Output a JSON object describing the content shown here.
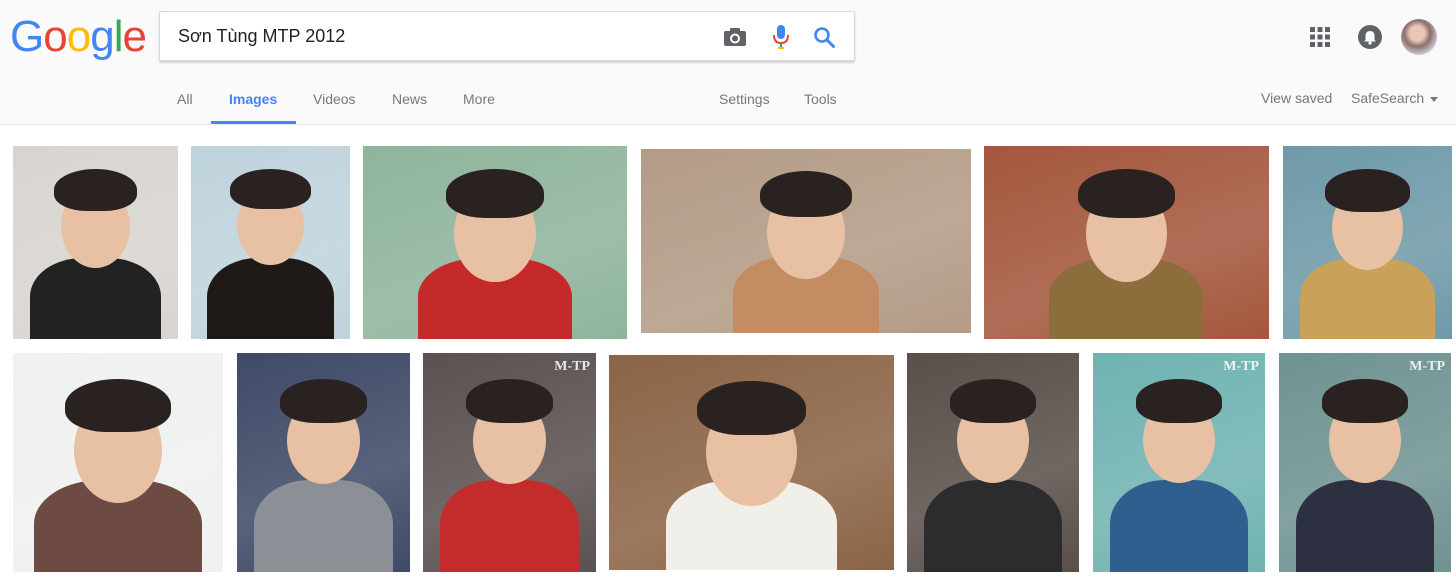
{
  "logo": {
    "text": [
      "G",
      "o",
      "o",
      "g",
      "l",
      "e"
    ],
    "colors": [
      "#4285f4",
      "#ea4335",
      "#fbbc05",
      "#4285f4",
      "#34a853",
      "#ea4335"
    ]
  },
  "search": {
    "query": "Sơn Tùng MTP 2012"
  },
  "icons": {
    "camera": "camera-icon",
    "mic": "microphone-icon",
    "search": "search-icon",
    "apps": "apps-grid-icon",
    "notifications": "notifications-bell-icon",
    "avatar": "account-avatar"
  },
  "tabs": [
    {
      "label": "All"
    },
    {
      "label": "Images",
      "active": true
    },
    {
      "label": "Videos"
    },
    {
      "label": "News"
    },
    {
      "label": "More"
    },
    {
      "label": "Settings"
    },
    {
      "label": "Tools"
    }
  ],
  "right_links": {
    "view_saved": "View saved",
    "safesearch": "SafeSearch"
  },
  "colors": {
    "accent": "#4285f4",
    "text_muted": "#777777",
    "header_bg": "#fafafa"
  },
  "images": [
    {
      "row": 1,
      "bg": "#d8d4cf",
      "accent": "#222222",
      "watermark": ""
    },
    {
      "row": 1,
      "bg": "#bfd3dc",
      "accent": "#1f1a18",
      "watermark": ""
    },
    {
      "row": 1,
      "bg": "#8fb49c",
      "accent": "#c42a2a",
      "watermark": ""
    },
    {
      "row": 1,
      "bg": "#b39b86",
      "accent": "#c48c62",
      "watermark": ""
    },
    {
      "row": 1,
      "bg": "#a4573d",
      "accent": "#8c6d3b",
      "watermark": ""
    },
    {
      "row": 1,
      "bg": "#6f9aa9",
      "accent": "#c9a15a",
      "watermark": ""
    },
    {
      "row": 2,
      "bg": "#eef1ef",
      "accent": "#6d4a42",
      "watermark": ""
    },
    {
      "row": 2,
      "bg": "#3e4a67",
      "accent": "#8c8f95",
      "watermark": ""
    },
    {
      "row": 2,
      "bg": "#5a5150",
      "accent": "#c42c2c",
      "watermark": "M-TP"
    },
    {
      "row": 2,
      "bg": "#8b6446",
      "accent": "#f1efe9",
      "watermark": ""
    },
    {
      "row": 2,
      "bg": "#5a4f4a",
      "accent": "#2c2c2e",
      "watermark": ""
    },
    {
      "row": 2,
      "bg": "#6fb3b1",
      "accent": "#2f5f8e",
      "watermark": "M-TP"
    },
    {
      "row": 2,
      "bg": "#6f9391",
      "accent": "#2c3040",
      "watermark": "M-TP"
    }
  ]
}
